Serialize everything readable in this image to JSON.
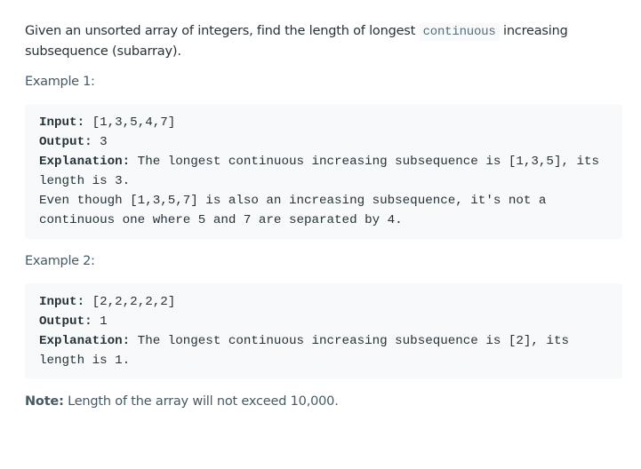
{
  "intro": {
    "before": "Given an unsorted array of integers, find the length of longest ",
    "code": "continuous",
    "after": " increasing subsequence (subarray)."
  },
  "examples": [
    {
      "title": "Example 1:",
      "input_label": "Input:",
      "input": " [1,3,5,4,7]",
      "output_label": "Output:",
      "output": " 3",
      "explanation_label": "Explanation:",
      "explanation": " The longest continuous increasing subsequence is [1,3,5], its length is 3.\nEven though [1,3,5,7] is also an increasing subsequence, it's not a continuous one where 5 and 7 are separated by 4."
    },
    {
      "title": "Example 2:",
      "input_label": "Input:",
      "input": " [2,2,2,2,2]",
      "output_label": "Output:",
      "output": " 1",
      "explanation_label": "Explanation:",
      "explanation": " The longest continuous increasing subsequence is [2], its length is 1."
    }
  ],
  "note": {
    "label": "Note:",
    "text": " Length of the array will not exceed 10,000."
  }
}
